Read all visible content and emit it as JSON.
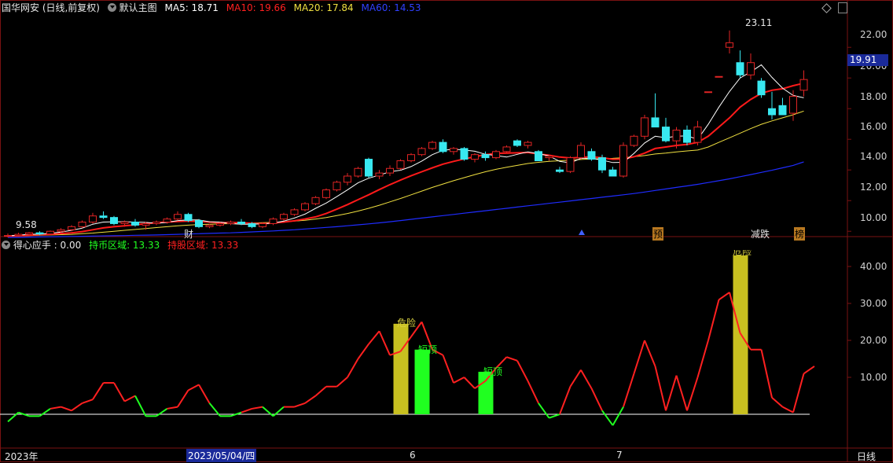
{
  "colors": {
    "background": "#000000",
    "grid": "#7a1212",
    "up": "#e02424",
    "down": "#38e8f0",
    "ma5": "#ffffff",
    "ma10": "#ff1a1a",
    "ma20": "#f0e040",
    "ma60": "#1f2cff",
    "ind_red": "#ff2020",
    "ind_green": "#20ff20",
    "ind_yellow": "#c8c020"
  },
  "main_header": {
    "title": "国华网安 (日线,前复权)",
    "mode": "默认主图",
    "ma5": "MA5: 18.71",
    "ma10": "MA10: 19.66",
    "ma20": "MA20: 17.84",
    "ma60": "MA60: 14.53"
  },
  "sub_header": {
    "title": "得心应手 : 0.00",
    "hold_cash": "持币区域: 13.33",
    "hold_stock": "持股区域: 13.33"
  },
  "price_axis": {
    "ticks": [
      "22.00",
      "20.00",
      "18.00",
      "16.00",
      "14.00",
      "12.00",
      "10.00"
    ],
    "current_price": "19.91",
    "high_marker": "23.11",
    "low_marker": "9.58"
  },
  "indicator_axis": {
    "ticks": [
      "40.00",
      "30.00",
      "20.00",
      "10.00"
    ]
  },
  "event_badges": {
    "cai": "财",
    "yu": "预",
    "jianchi": "减跌",
    "bang": "榜"
  },
  "signal_labels": {
    "danger": "危险",
    "top1": "短顶",
    "top2": "短顶",
    "top3": "危险"
  },
  "date_axis": {
    "year": "2023年",
    "cursor_date": "2023/05/04/四",
    "month6": "6",
    "month7": "7",
    "period": "日线"
  },
  "chart_data": {
    "type": "candlestick",
    "price_range": [
      9.3,
      23.6
    ],
    "candles": [
      [
        9.7,
        9.85,
        9.6,
        9.72
      ],
      [
        9.72,
        9.9,
        9.65,
        9.8
      ],
      [
        9.8,
        9.95,
        9.7,
        9.9
      ],
      [
        9.9,
        10.0,
        9.75,
        9.82
      ],
      [
        9.82,
        10.05,
        9.78,
        10.0
      ],
      [
        10.0,
        10.2,
        9.9,
        10.1
      ],
      [
        10.1,
        10.4,
        10.0,
        10.3
      ],
      [
        10.3,
        10.7,
        10.2,
        10.6
      ],
      [
        10.6,
        11.2,
        10.5,
        11.0
      ],
      [
        11.0,
        11.3,
        10.8,
        10.9
      ],
      [
        10.9,
        11.0,
        10.4,
        10.5
      ],
      [
        10.5,
        10.7,
        10.3,
        10.6
      ],
      [
        10.6,
        10.8,
        10.3,
        10.4
      ],
      [
        10.4,
        10.6,
        10.1,
        10.5
      ],
      [
        10.5,
        10.7,
        10.4,
        10.6
      ],
      [
        10.6,
        10.9,
        10.5,
        10.8
      ],
      [
        10.8,
        11.3,
        10.7,
        11.1
      ],
      [
        11.1,
        11.2,
        10.6,
        10.7
      ],
      [
        10.7,
        10.8,
        10.2,
        10.3
      ],
      [
        10.3,
        10.5,
        10.2,
        10.4
      ],
      [
        10.4,
        10.6,
        10.3,
        10.5
      ],
      [
        10.5,
        10.7,
        10.4,
        10.6
      ],
      [
        10.6,
        10.8,
        10.4,
        10.5
      ],
      [
        10.5,
        10.6,
        10.2,
        10.3
      ],
      [
        10.3,
        10.6,
        10.2,
        10.5
      ],
      [
        10.5,
        10.9,
        10.4,
        10.8
      ],
      [
        10.8,
        11.2,
        10.7,
        11.1
      ],
      [
        11.1,
        11.5,
        11.0,
        11.4
      ],
      [
        11.4,
        11.9,
        11.3,
        11.8
      ],
      [
        11.8,
        12.3,
        11.7,
        12.2
      ],
      [
        12.2,
        12.8,
        12.1,
        12.7
      ],
      [
        12.7,
        13.3,
        12.6,
        13.2
      ],
      [
        13.2,
        13.8,
        13.0,
        13.6
      ],
      [
        13.6,
        14.2,
        13.5,
        14.1
      ],
      [
        14.7,
        14.8,
        13.5,
        13.6
      ],
      [
        13.6,
        14.0,
        13.4,
        13.8
      ],
      [
        13.8,
        14.3,
        13.6,
        14.1
      ],
      [
        14.1,
        14.7,
        14.0,
        14.6
      ],
      [
        14.6,
        15.1,
        14.5,
        15.0
      ],
      [
        15.0,
        15.5,
        14.9,
        15.4
      ],
      [
        15.4,
        15.9,
        15.3,
        15.8
      ],
      [
        15.8,
        16.0,
        15.1,
        15.2
      ],
      [
        15.2,
        15.5,
        15.0,
        15.4
      ],
      [
        15.4,
        15.5,
        14.6,
        14.7
      ],
      [
        14.7,
        15.1,
        14.5,
        15.0
      ],
      [
        15.0,
        15.2,
        14.6,
        14.8
      ],
      [
        14.8,
        15.3,
        14.7,
        15.2
      ],
      [
        15.2,
        15.6,
        15.1,
        15.5
      ],
      [
        15.9,
        16.0,
        15.5,
        15.6
      ],
      [
        15.6,
        15.9,
        15.4,
        15.8
      ],
      [
        15.2,
        15.3,
        14.6,
        14.6
      ],
      [
        14.8,
        15.0,
        14.6,
        14.9
      ],
      [
        14.0,
        14.2,
        13.8,
        13.9
      ],
      [
        13.9,
        14.9,
        13.8,
        14.8
      ],
      [
        14.8,
        15.8,
        14.7,
        15.6
      ],
      [
        15.2,
        15.4,
        14.6,
        14.7
      ],
      [
        14.8,
        15.0,
        13.8,
        14.0
      ],
      [
        14.0,
        14.2,
        13.6,
        13.6
      ],
      [
        13.6,
        15.8,
        13.5,
        15.6
      ],
      [
        15.6,
        16.3,
        15.5,
        16.2
      ],
      [
        16.2,
        17.6,
        16.0,
        17.4
      ],
      [
        17.4,
        19.0,
        17.0,
        16.8
      ],
      [
        16.8,
        17.4,
        15.8,
        15.9
      ],
      [
        15.9,
        16.8,
        15.4,
        16.6
      ],
      [
        16.6,
        16.9,
        15.6,
        15.8
      ],
      [
        15.8,
        17.2,
        15.6,
        16.8
      ],
      [
        19.1,
        19.1,
        19.1,
        19.1
      ],
      [
        20.1,
        20.1,
        20.1,
        20.1
      ],
      [
        22.0,
        23.1,
        21.6,
        22.3
      ],
      [
        21.0,
        21.8,
        20.0,
        20.2
      ],
      [
        20.2,
        21.6,
        19.9,
        21.0
      ],
      [
        19.8,
        20.0,
        18.7,
        18.9
      ],
      [
        18.0,
        19.1,
        17.3,
        17.6
      ],
      [
        18.2,
        18.7,
        17.6,
        17.6
      ],
      [
        17.7,
        19.2,
        17.2,
        18.8
      ],
      [
        19.2,
        20.5,
        18.8,
        19.9
      ]
    ],
    "ma5": [
      9.7,
      9.75,
      9.8,
      9.82,
      9.86,
      9.95,
      10.06,
      10.2,
      10.46,
      10.6,
      10.62,
      10.62,
      10.6,
      10.58,
      10.52,
      10.58,
      10.7,
      10.74,
      10.74,
      10.62,
      10.6,
      10.5,
      10.46,
      10.46,
      10.48,
      10.54,
      10.66,
      10.86,
      11.12,
      11.5,
      11.84,
      12.26,
      12.7,
      13.16,
      13.46,
      13.66,
      13.88,
      13.98,
      14.22,
      14.58,
      15.0,
      15.28,
      15.36,
      15.3,
      15.22,
      15.02,
      14.94,
      14.84,
      15.02,
      15.18,
      15.06,
      14.92,
      14.56,
      14.46,
      14.76,
      14.76,
      14.64,
      14.48,
      14.5,
      15.08,
      15.76,
      16.2,
      16.1,
      16.2,
      16.22,
      16.0,
      16.98,
      18.1,
      19.12,
      20.0,
      20.4,
      20.86,
      20.04,
      19.34,
      18.86,
      18.71
    ],
    "ma10": [
      9.7,
      9.72,
      9.75,
      9.78,
      9.8,
      9.85,
      9.9,
      9.98,
      10.1,
      10.22,
      10.3,
      10.36,
      10.42,
      10.5,
      10.56,
      10.6,
      10.64,
      10.66,
      10.64,
      10.6,
      10.56,
      10.56,
      10.56,
      10.52,
      10.5,
      10.54,
      10.6,
      10.68,
      10.8,
      10.94,
      11.16,
      11.44,
      11.74,
      12.06,
      12.38,
      12.72,
      13.04,
      13.34,
      13.62,
      13.88,
      14.14,
      14.38,
      14.56,
      14.72,
      14.86,
      15.0,
      15.08,
      15.1,
      15.12,
      15.14,
      15.04,
      14.96,
      14.84,
      14.78,
      14.82,
      14.86,
      14.8,
      14.7,
      14.72,
      14.86,
      15.1,
      15.4,
      15.5,
      15.6,
      15.66,
      15.8,
      16.2,
      16.8,
      17.4,
      18.1,
      18.6,
      19.0,
      19.2,
      19.3,
      19.5,
      19.66
    ],
    "ma20": [
      9.7,
      9.7,
      9.72,
      9.74,
      9.76,
      9.78,
      9.8,
      9.84,
      9.88,
      9.94,
      10.0,
      10.06,
      10.12,
      10.18,
      10.24,
      10.3,
      10.36,
      10.4,
      10.44,
      10.46,
      10.48,
      10.5,
      10.52,
      10.54,
      10.56,
      10.58,
      10.6,
      10.66,
      10.72,
      10.8,
      10.9,
      11.02,
      11.16,
      11.32,
      11.5,
      11.7,
      11.92,
      12.14,
      12.38,
      12.62,
      12.86,
      13.08,
      13.3,
      13.5,
      13.7,
      13.88,
      14.04,
      14.18,
      14.3,
      14.42,
      14.5,
      14.56,
      14.6,
      14.64,
      14.68,
      14.72,
      14.74,
      14.76,
      14.8,
      14.86,
      14.94,
      15.04,
      15.1,
      15.18,
      15.24,
      15.3,
      15.5,
      15.8,
      16.1,
      16.4,
      16.7,
      16.98,
      17.2,
      17.4,
      17.6,
      17.84
    ],
    "ma60": [
      9.6,
      9.6,
      9.62,
      9.63,
      9.64,
      9.65,
      9.66,
      9.67,
      9.68,
      9.7,
      9.71,
      9.72,
      9.74,
      9.75,
      9.76,
      9.78,
      9.8,
      9.82,
      9.84,
      9.86,
      9.88,
      9.9,
      9.93,
      9.96,
      9.99,
      10.02,
      10.06,
      10.1,
      10.15,
      10.2,
      10.25,
      10.3,
      10.36,
      10.42,
      10.48,
      10.55,
      10.62,
      10.7,
      10.78,
      10.86,
      10.94,
      11.02,
      11.1,
      11.18,
      11.26,
      11.34,
      11.42,
      11.5,
      11.58,
      11.66,
      11.74,
      11.82,
      11.9,
      11.98,
      12.06,
      12.14,
      12.22,
      12.3,
      12.38,
      12.46,
      12.56,
      12.66,
      12.76,
      12.86,
      12.96,
      13.06,
      13.18,
      13.3,
      13.42,
      13.56,
      13.7,
      13.84,
      13.98,
      14.14,
      14.3,
      14.53
    ],
    "indicator": {
      "range": [
        -5,
        48
      ],
      "line": [
        -2,
        0.5,
        -0.5,
        -0.5,
        1.5,
        2,
        1,
        3,
        4,
        8.5,
        8.5,
        3.5,
        5,
        -0.5,
        -0.5,
        1.5,
        2,
        6.5,
        8,
        3,
        -0.5,
        -0.5,
        0.5,
        1.5,
        2,
        -0.5,
        2,
        2,
        3,
        5,
        7.5,
        7.5,
        10,
        15,
        19,
        22.5,
        16,
        17,
        21,
        25,
        17.5,
        16,
        8.5,
        10,
        7,
        9,
        12.5,
        15.5,
        14.5,
        9,
        3,
        -1,
        0,
        7.5,
        12,
        7,
        1,
        -3,
        2,
        11,
        20,
        13,
        1,
        10.5,
        1,
        10,
        20,
        31,
        33,
        22,
        17.5,
        17.5,
        4.5,
        2,
        0.5,
        11,
        13
      ],
      "bars": [
        {
          "index": 37,
          "value": 24.5,
          "color": "yellow"
        },
        {
          "index": 39,
          "value": 17.5,
          "color": "green"
        },
        {
          "index": 45,
          "value": 11.5,
          "color": "green"
        },
        {
          "index": 69,
          "value": 43.0,
          "color": "yellow"
        }
      ]
    }
  }
}
